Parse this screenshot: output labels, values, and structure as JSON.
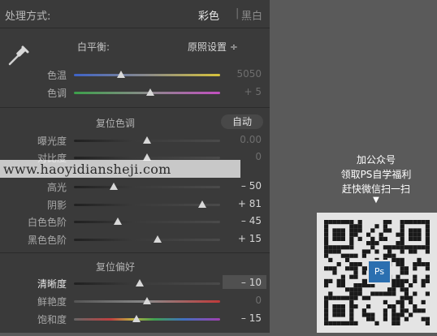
{
  "header": {
    "label": "处理方式:",
    "mode_color": "彩色",
    "mode_sep": "|",
    "mode_bw": "黑白"
  },
  "white_balance": {
    "label": "白平衡:",
    "preset": "原照设置 ÷"
  },
  "basic_rows": [
    {
      "label": "色温",
      "value": "5050",
      "level": 0.32
    },
    {
      "label": "色调",
      "value": "+ 5",
      "level": 0.52
    }
  ],
  "tone_section": {
    "reset_label": "复位色调",
    "auto_label": "自动"
  },
  "tone_rows": [
    {
      "label": "曝光度",
      "value": "0.00",
      "level": 0.5
    },
    {
      "label": "对比度",
      "value": "0",
      "level": 0.5
    },
    {
      "label": "高光",
      "value": "– 50",
      "level": 0.27
    },
    {
      "label": "阴影",
      "value": "+ 81",
      "level": 0.88
    },
    {
      "label": "白色色阶",
      "value": "– 45",
      "level": 0.3
    },
    {
      "label": "黑色色阶",
      "value": "+ 15",
      "level": 0.57
    }
  ],
  "presence_section": {
    "reset_label": "复位偏好"
  },
  "presence_rows": [
    {
      "label": "清晰度",
      "value": "– 10",
      "level": 0.45
    },
    {
      "label": "鲜艳度",
      "value": "0",
      "level": 0.5
    },
    {
      "label": "饱和度",
      "value": "– 15",
      "level": 0.43
    }
  ],
  "watermark": {
    "text": "www.haoyidiansheji.com"
  },
  "promo": {
    "line1": "加公众号",
    "line2": "领取PS自学福利",
    "line3": "赶快微信扫一扫",
    "arrow": "▼",
    "logo": "Ps"
  },
  "colors": {
    "panel_bg": "#3a3a3a",
    "page_bg": "#5a5a5a",
    "ps_blue": "#2b6fb0"
  }
}
